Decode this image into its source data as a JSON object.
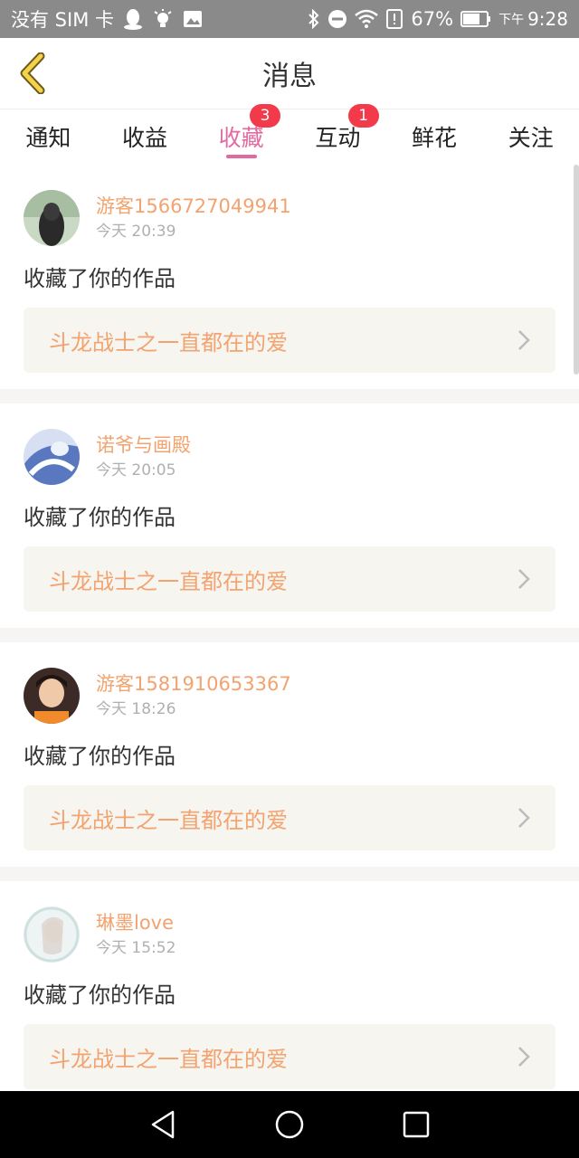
{
  "status_bar": {
    "carrier": "没有 SIM 卡",
    "battery": "67%",
    "time_prefix": "下午",
    "time": "9:28"
  },
  "header": {
    "title": "消息",
    "back_icon": "back-chevron-icon"
  },
  "tabs": [
    {
      "label": "通知",
      "badge": ""
    },
    {
      "label": "收益",
      "badge": ""
    },
    {
      "label": "收藏",
      "badge": "3",
      "active": true
    },
    {
      "label": "互动",
      "badge": "1"
    },
    {
      "label": "鲜花",
      "badge": ""
    },
    {
      "label": "关注",
      "badge": ""
    }
  ],
  "messages": [
    {
      "user": "游客1566727049941",
      "time": "今天 20:39",
      "action": "收藏了你的作品",
      "work": "斗龙战士之一直都在的爱"
    },
    {
      "user": "诺爷与画殿",
      "time": "今天 20:05",
      "action": "收藏了你的作品",
      "work": "斗龙战士之一直都在的爱"
    },
    {
      "user": "游客1581910653367",
      "time": "今天 18:26",
      "action": "收藏了你的作品",
      "work": "斗龙战士之一直都在的爱"
    },
    {
      "user": "琳墨love",
      "time": "今天 15:52",
      "action": "收藏了你的作品",
      "work": "斗龙战士之一直都在的爱"
    }
  ],
  "colors": {
    "accent": "#e36aa0",
    "username": "#f2a36f",
    "badge": "#f23a4a"
  }
}
